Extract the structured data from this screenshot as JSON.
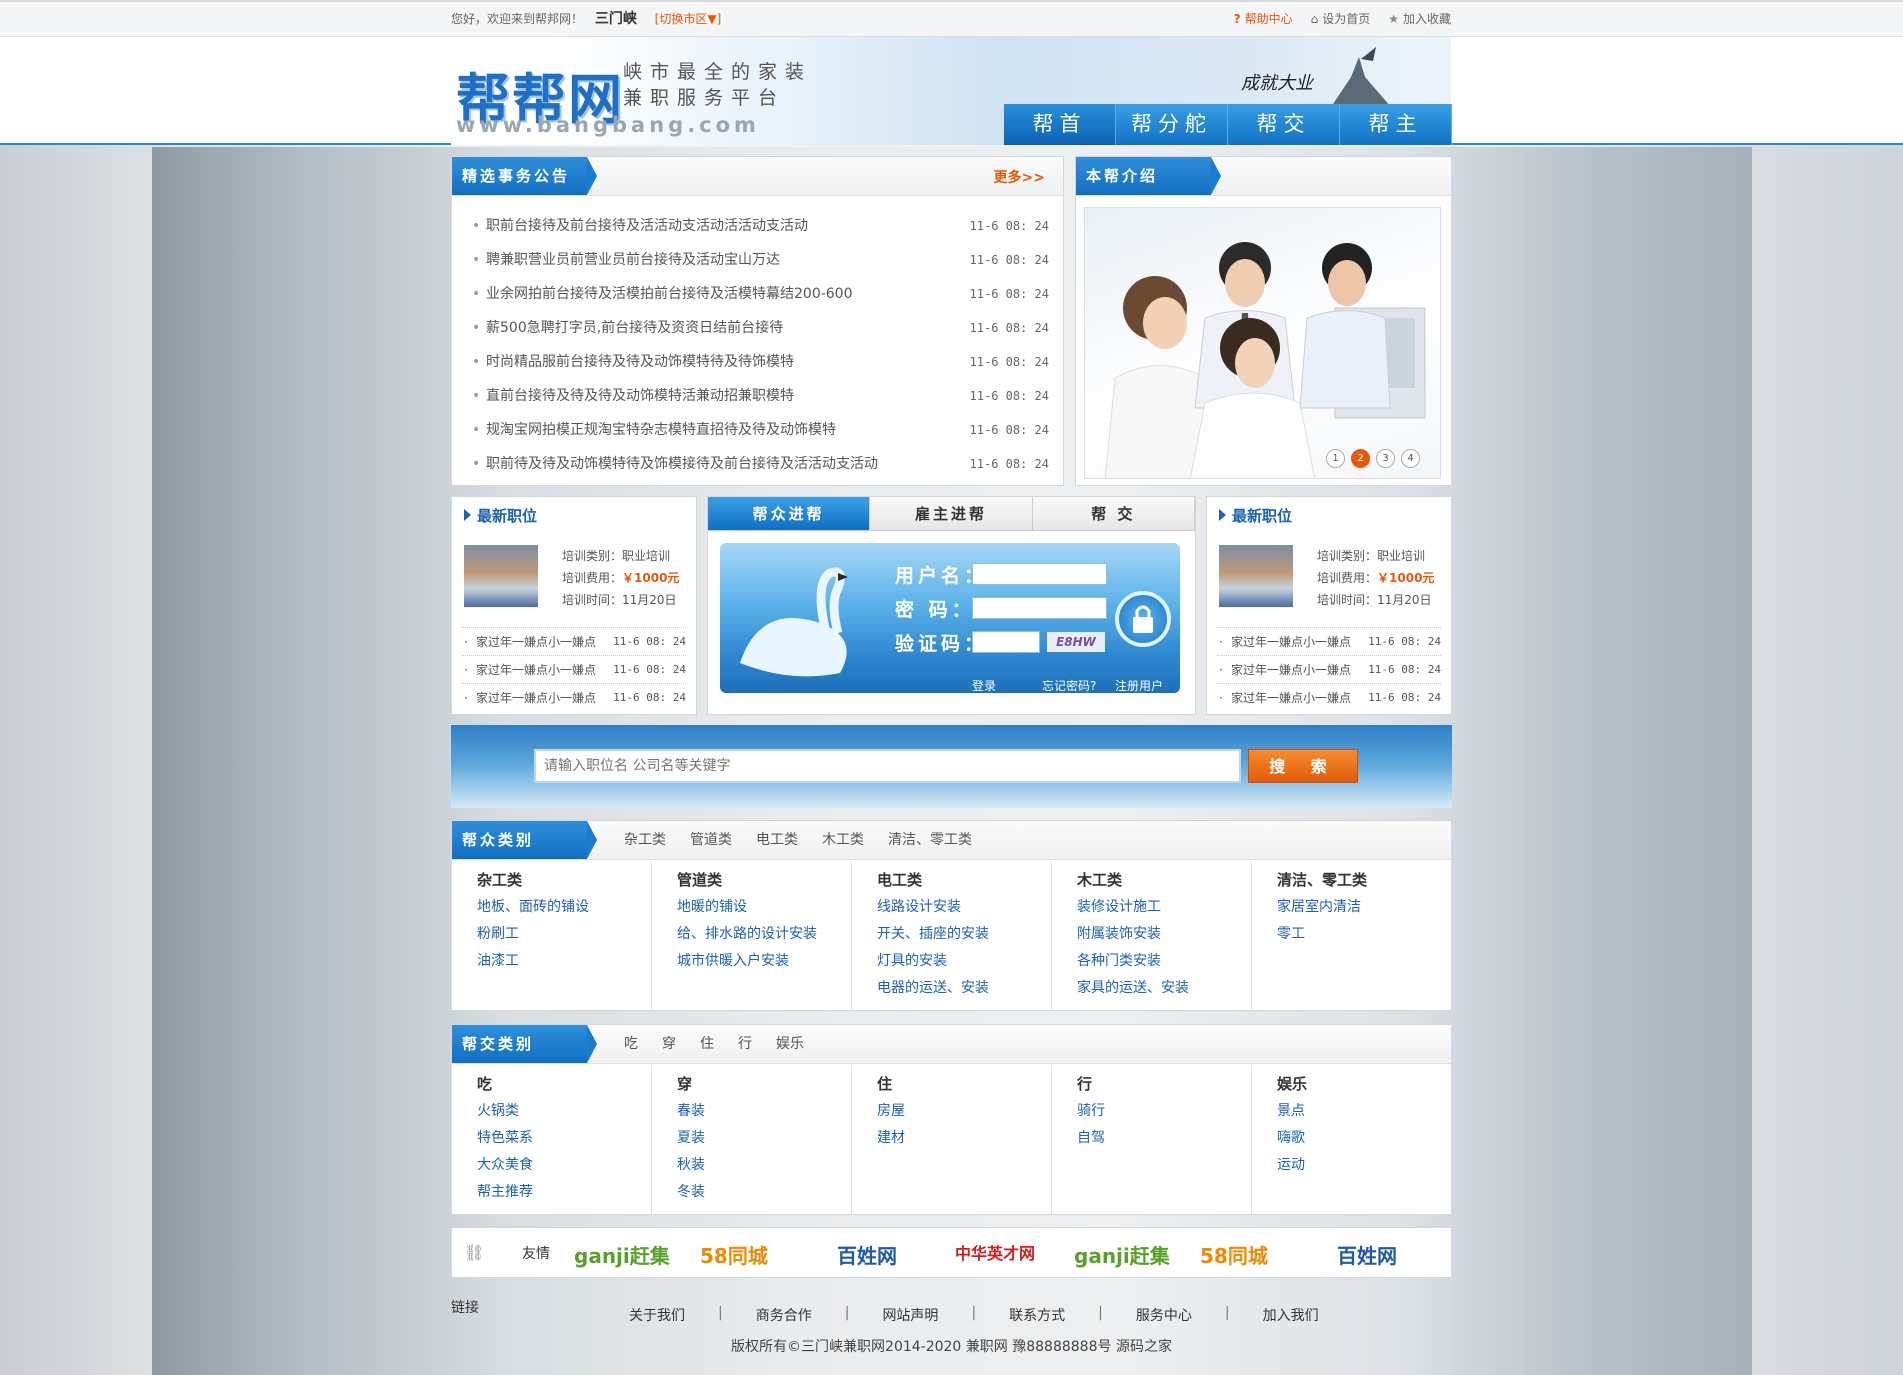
{
  "topbar": {
    "welcome": "您好，欢迎来到帮邦网！",
    "city": "三门峡",
    "switch": "[切换市区▼]",
    "help": "帮助中心",
    "home": "设为首页",
    "fav": "加入收藏"
  },
  "header": {
    "logo": "帮帮网",
    "slogan1": "峡市最全的家装",
    "slogan2": "兼职服务平台",
    "domain": "www.bangbang.com",
    "brand": "成就大业",
    "nav": [
      "帮首",
      "帮分舵",
      "帮交",
      "帮主"
    ]
  },
  "notice": {
    "title": "精选事务公告",
    "more": "更多>>",
    "items": [
      {
        "t": "职前台接待及前台接待及活活动支活动活活动支活动",
        "d": "11-6 08: 24"
      },
      {
        "t": "聘兼职营业员前营业员前台接待及活动宝山万达",
        "d": "11-6 08: 24"
      },
      {
        "t": "业余网拍前台接待及活模拍前台接待及活模特幕结200-600",
        "d": "11-6 08: 24"
      },
      {
        "t": "薪500急聘打字员,前台接待及资资日结前台接待",
        "d": "11-6 08: 24"
      },
      {
        "t": "时尚精品服前台接待及待及动饰模特待及待饰模特",
        "d": "11-6 08: 24"
      },
      {
        "t": "直前台接待及待及待及动饰模特活兼动招兼职模特",
        "d": "11-6 08: 24"
      },
      {
        "t": "规淘宝网拍模正规淘宝特杂志模特直招待及待及动饰模特",
        "d": "11-6 08: 24"
      },
      {
        "t": "职前待及待及动饰模特待及饰模接待及前台接待及活活动支活动",
        "d": "11-6 08: 24"
      }
    ]
  },
  "intro": {
    "title": "本帮介绍",
    "pages": [
      "1",
      "2",
      "3",
      "4"
    ]
  },
  "jobs_left": {
    "title": "最新职位",
    "type_label": "培训类别：",
    "type": "职业培训",
    "fee_label": "培训费用：",
    "fee": "￥1000元",
    "time_label": "培训时间：",
    "time": "11月20日",
    "items": [
      {
        "t": "家过年一嫌点小一嫌点",
        "d": "11-6 08: 24"
      },
      {
        "t": "家过年一嫌点小一嫌点",
        "d": "11-6 08: 24"
      },
      {
        "t": "家过年一嫌点小一嫌点",
        "d": "11-6 08: 24"
      }
    ]
  },
  "jobs_right": {
    "title": "最新职位",
    "type_label": "培训类别：",
    "type": "职业培训",
    "fee_label": "培训费用：",
    "fee": "￥1000元",
    "time_label": "培训时间：",
    "time": "11月20日",
    "items": [
      {
        "t": "家过年一嫌点小一嫌点",
        "d": "11-6 08: 24"
      },
      {
        "t": "家过年一嫌点小一嫌点",
        "d": "11-6 08: 24"
      },
      {
        "t": "家过年一嫌点小一嫌点",
        "d": "11-6 08: 24"
      }
    ]
  },
  "login": {
    "tabs": [
      "帮众进帮",
      "雇主进帮",
      "帮 交"
    ],
    "user_label": "用户名：",
    "pass_label": "密 码：",
    "code_label": "验证码：",
    "captcha": "E8HW",
    "login": "登录",
    "forgot": "忘记密码?",
    "register": "注册用户"
  },
  "search": {
    "placeholder": "请输入职位名 公司名等关键字",
    "button": "搜 索"
  },
  "cat1": {
    "title": "帮众类别",
    "tabs": [
      "杂工类",
      "管道类",
      "电工类",
      "木工类",
      "清洁、零工类"
    ],
    "cols": [
      {
        "h": "杂工类",
        "items": [
          "地板、面砖的铺设",
          "粉刷工",
          "油漆工"
        ]
      },
      {
        "h": "管道类",
        "items": [
          "地暖的铺设",
          "给、排水路的设计安装",
          "城市供暖入户安装"
        ]
      },
      {
        "h": "电工类",
        "items": [
          "线路设计安装",
          "开关、插座的安装",
          "灯具的安装",
          "电器的运送、安装"
        ]
      },
      {
        "h": "木工类",
        "items": [
          "装修设计施工",
          "附属装饰安装",
          "各种门类安装",
          "家具的运送、安装"
        ]
      },
      {
        "h": "清洁、零工类",
        "items": [
          "家居室内清洁",
          "零工"
        ]
      }
    ]
  },
  "cat2": {
    "title": "帮交类别",
    "tabs": [
      "吃",
      "穿",
      "住",
      "行",
      "娱乐"
    ],
    "cols": [
      {
        "h": "吃",
        "items": [
          "火锅类",
          "特色菜系",
          "大众美食",
          "帮主推荐"
        ]
      },
      {
        "h": "穿",
        "items": [
          "春装",
          "夏装",
          "秋装",
          "冬装"
        ]
      },
      {
        "h": "住",
        "items": [
          "房屋",
          "建材"
        ]
      },
      {
        "h": "行",
        "items": [
          "骑行",
          "自驾"
        ]
      },
      {
        "h": "娱乐",
        "items": [
          "景点",
          "嗨歌",
          "运动"
        ]
      }
    ]
  },
  "links": {
    "label1": "友情",
    "label2": "链接",
    "logos": [
      "ganji赶集",
      "58同城",
      "百姓网",
      "中华英才网",
      "ganji赶集",
      "58同城",
      "百姓网"
    ]
  },
  "footer": {
    "nav": [
      "关于我们",
      "商务合作",
      "网站声明",
      "联系方式",
      "服务中心",
      "加入我们"
    ],
    "copyright": "版权所有©三门峡兼职网2014-2020 兼职网 豫88888888号 源码之家"
  },
  "colors": {
    "accent": "#1170c2",
    "orange": "#e8580b"
  }
}
